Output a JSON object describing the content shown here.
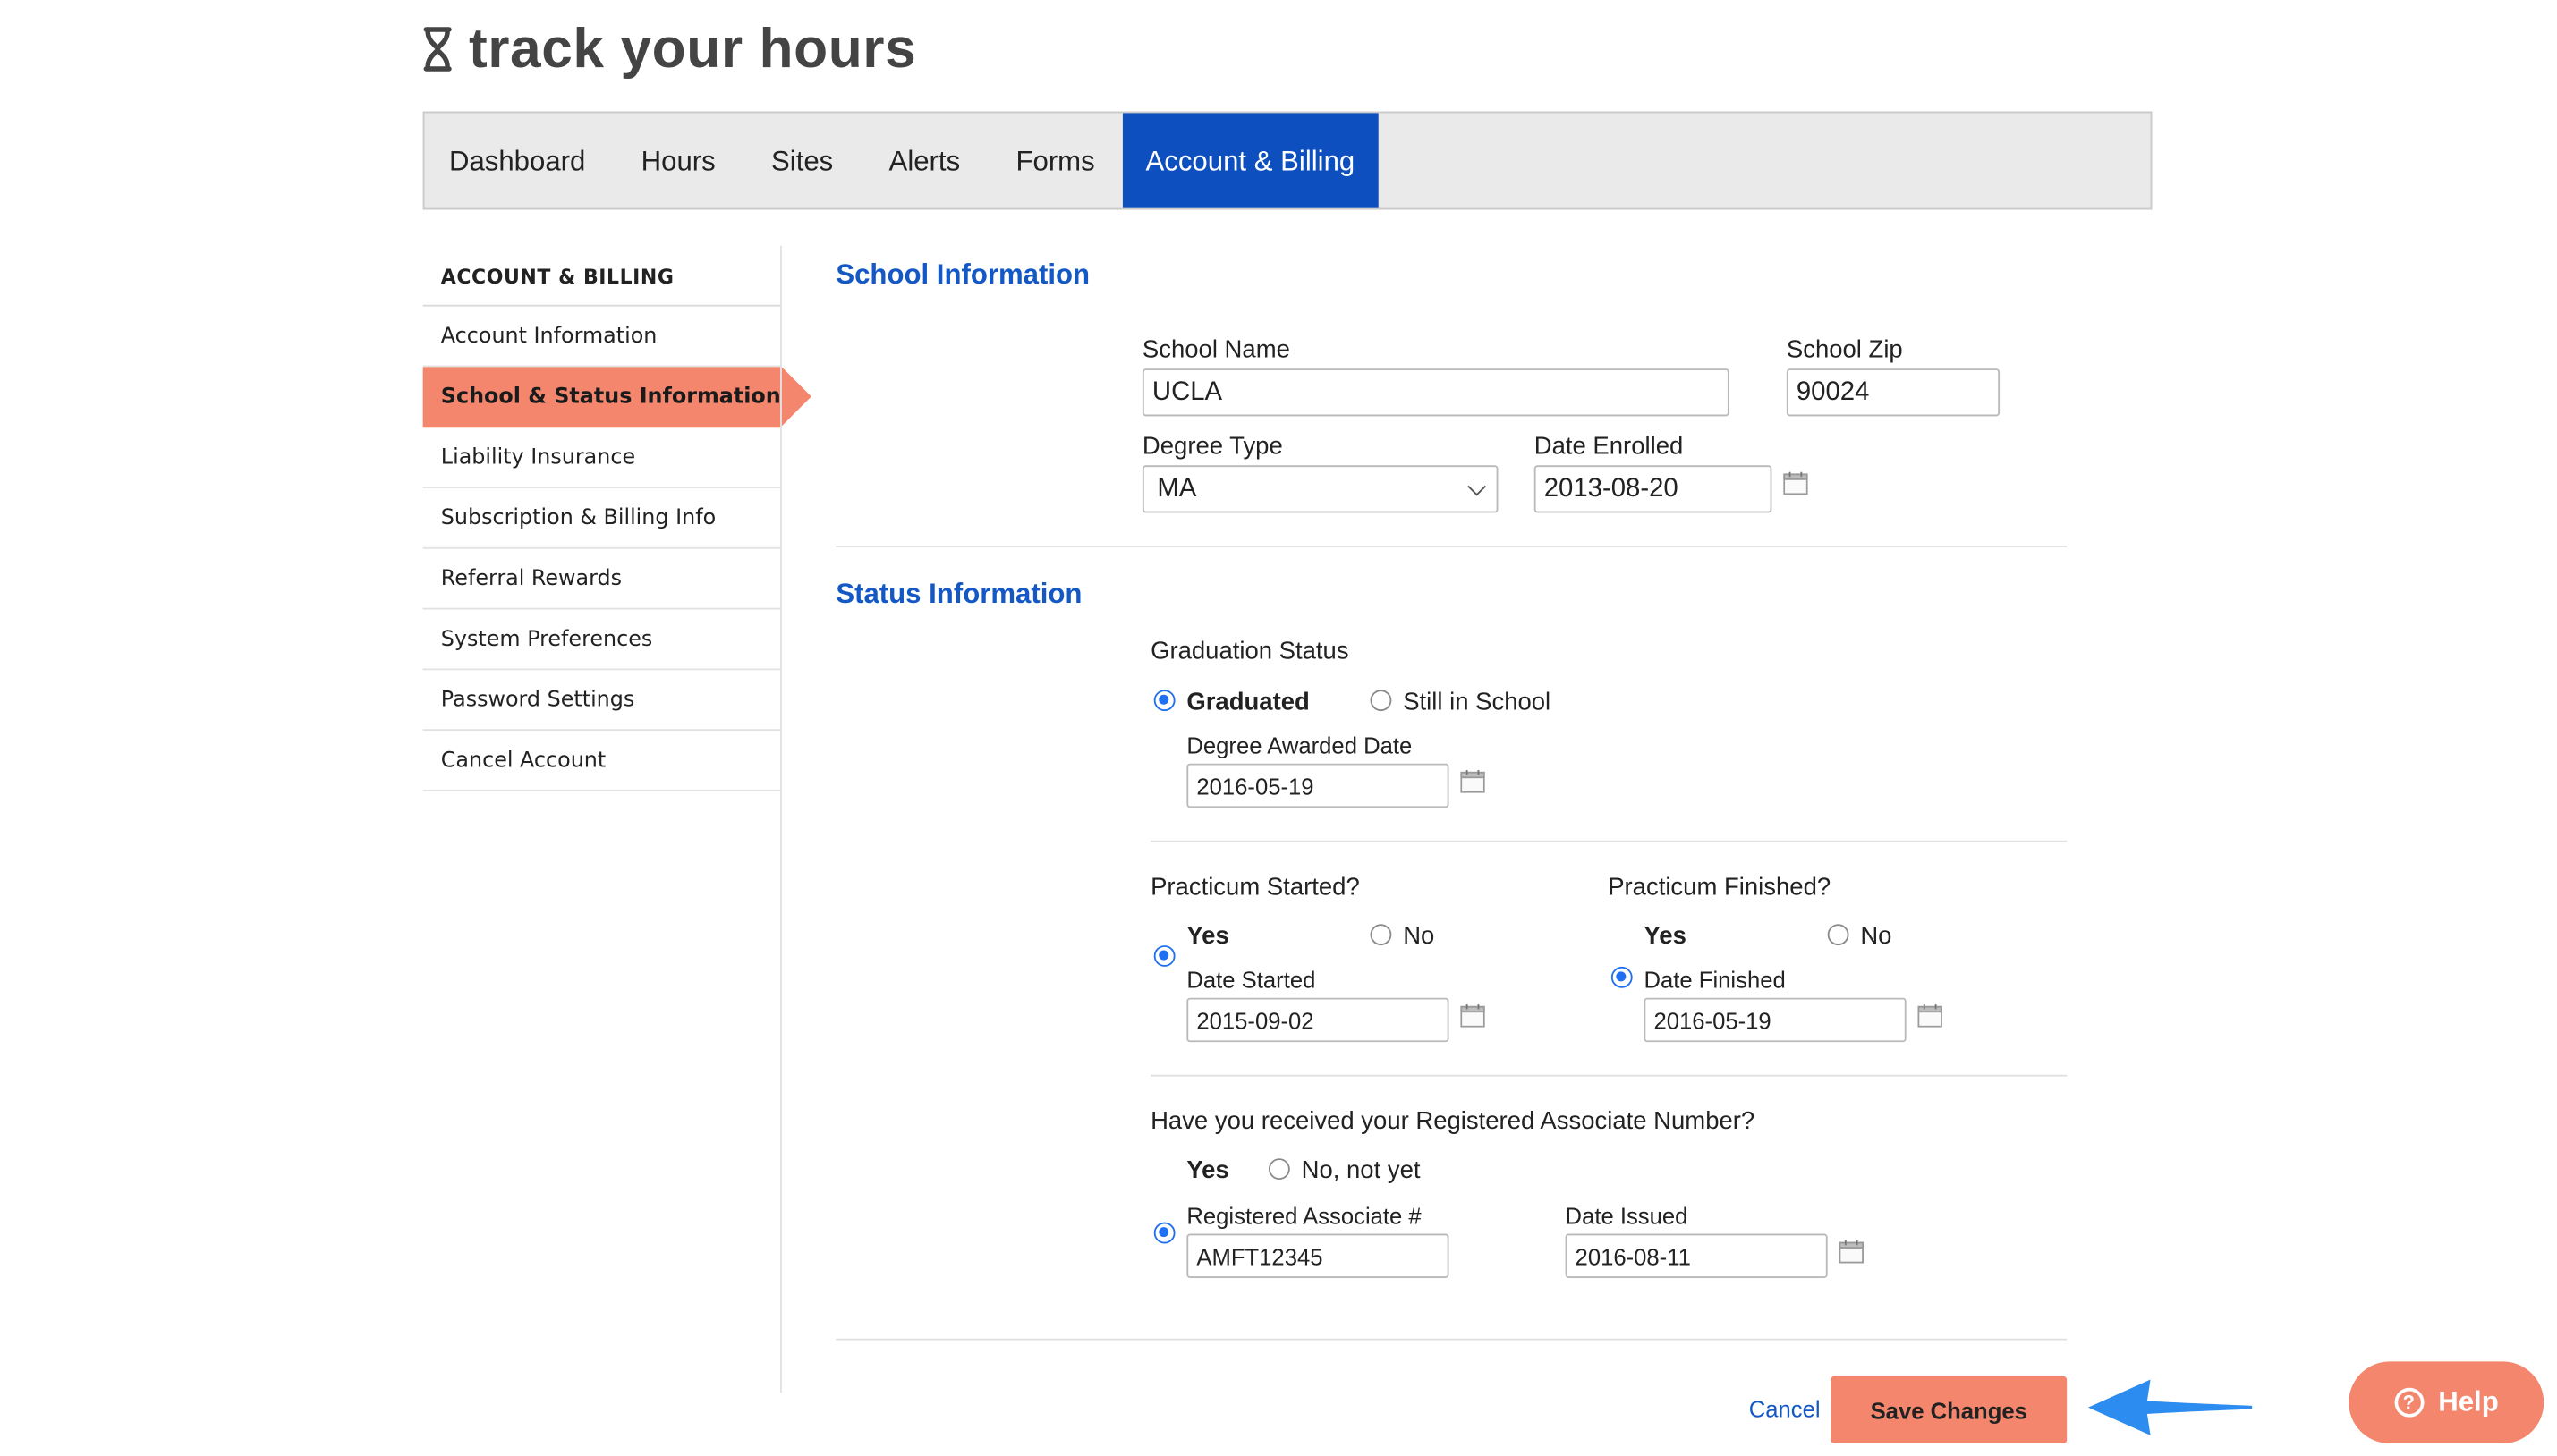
{
  "app": {
    "logo_text": "track your hours"
  },
  "nav": {
    "items": [
      {
        "label": "Dashboard"
      },
      {
        "label": "Hours"
      },
      {
        "label": "Sites"
      },
      {
        "label": "Alerts"
      },
      {
        "label": "Forms"
      },
      {
        "label": "Account & Billing",
        "active": true
      }
    ]
  },
  "sidebar": {
    "heading": "ACCOUNT & BILLING",
    "items": [
      {
        "label": "Account Information"
      },
      {
        "label": "School & Status Information",
        "active": true
      },
      {
        "label": "Liability Insurance"
      },
      {
        "label": "Subscription & Billing Info"
      },
      {
        "label": "Referral Rewards"
      },
      {
        "label": "System Preferences"
      },
      {
        "label": "Password Settings"
      },
      {
        "label": "Cancel Account"
      }
    ]
  },
  "school": {
    "title": "School Information",
    "name_label": "School Name",
    "name_value": "UCLA",
    "zip_label": "School Zip",
    "zip_value": "90024",
    "degree_label": "Degree Type",
    "degree_value": "MA",
    "enrolled_label": "Date Enrolled",
    "enrolled_value": "2013-08-20"
  },
  "status": {
    "title": "Status Information",
    "graduation": {
      "label": "Graduation Status",
      "option_yes": "Graduated",
      "option_no": "Still in School",
      "date_label": "Degree Awarded Date",
      "date_value": "2016-05-19"
    },
    "practicum_started": {
      "label": "Practicum Started?",
      "option_yes": "Yes",
      "option_no": "No",
      "date_label": "Date Started",
      "date_value": "2015-09-02"
    },
    "practicum_finished": {
      "label": "Practicum Finished?",
      "option_yes": "Yes",
      "option_no": "No",
      "date_label": "Date Finished",
      "date_value": "2016-05-19"
    },
    "registered": {
      "label": "Have you received your Registered Associate Number?",
      "option_yes": "Yes",
      "option_no": "No, not yet",
      "number_label": "Registered Associate #",
      "number_value": "AMFT12345",
      "date_label": "Date Issued",
      "date_value": "2016-08-11"
    }
  },
  "actions": {
    "cancel_label": "Cancel",
    "save_label": "Save Changes"
  },
  "help": {
    "label": "Help"
  },
  "colors": {
    "accent": "#f4866d",
    "nav_active": "#0e4fbf",
    "link": "#1358c4",
    "radio": "#1f6ff0",
    "arrow": "#2d8cf0"
  }
}
